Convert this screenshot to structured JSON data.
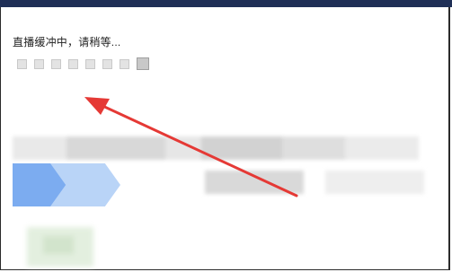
{
  "page": {
    "status": "直播缓冲中，请稍等..."
  },
  "loader": {
    "squares": 8,
    "active_index": 7
  },
  "annotation": {
    "color": "#e53935"
  }
}
